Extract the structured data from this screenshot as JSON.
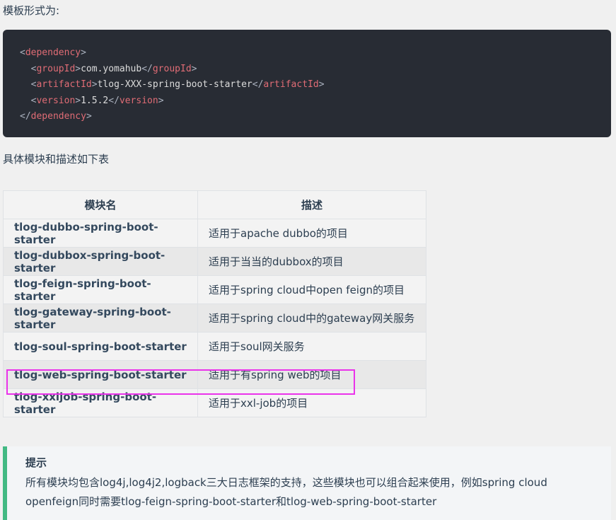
{
  "intro_text": "模板形式为:",
  "code": {
    "line1_tag": "dependency",
    "line2_tag": "groupId",
    "line2_value": "com.yomahub",
    "line3_tag": "artifactId",
    "line3_value": "tlog-XXX-spring-boot-starter",
    "line4_tag": "version",
    "line4_value": "1.5.2",
    "line5_tag": "dependency"
  },
  "table_intro": "具体模块和描述如下表",
  "table": {
    "headers": [
      "模块名",
      "描述"
    ],
    "rows": [
      {
        "name": "tlog-dubbo-spring-boot-starter",
        "desc": "适用于apache dubbo的项目"
      },
      {
        "name": "tlog-dubbox-spring-boot-starter",
        "desc": "适用于当当的dubbox的项目"
      },
      {
        "name": "tlog-feign-spring-boot-starter",
        "desc": "适用于spring cloud中open feign的项目"
      },
      {
        "name": "tlog-gateway-spring-boot-starter",
        "desc": "适用于spring cloud中的gateway网关服务"
      },
      {
        "name": "tlog-soul-spring-boot-starter",
        "desc": "适用于soul网关服务"
      },
      {
        "name": "tlog-web-spring-boot-starter",
        "desc": "适用于有spring web的项目"
      },
      {
        "name": "tlog-xxljob-spring-boot-starter",
        "desc": "适用于xxl-job的项目"
      }
    ]
  },
  "tip": {
    "title": "提示",
    "body_line1": "所有模块均包含log4j,log4j2,logback三大日志框架的支持，这些模块也可以组合起来使用，例如spring cloud",
    "body_line2": "openfeign同时需要tlog-feign-spring-boot-starter和tlog-web-spring-boot-starter"
  },
  "colors": {
    "code_background": "#282c34",
    "tag_color": "#e06c75",
    "tip_accent": "#42b983",
    "highlight_border": "#ea33ea"
  }
}
